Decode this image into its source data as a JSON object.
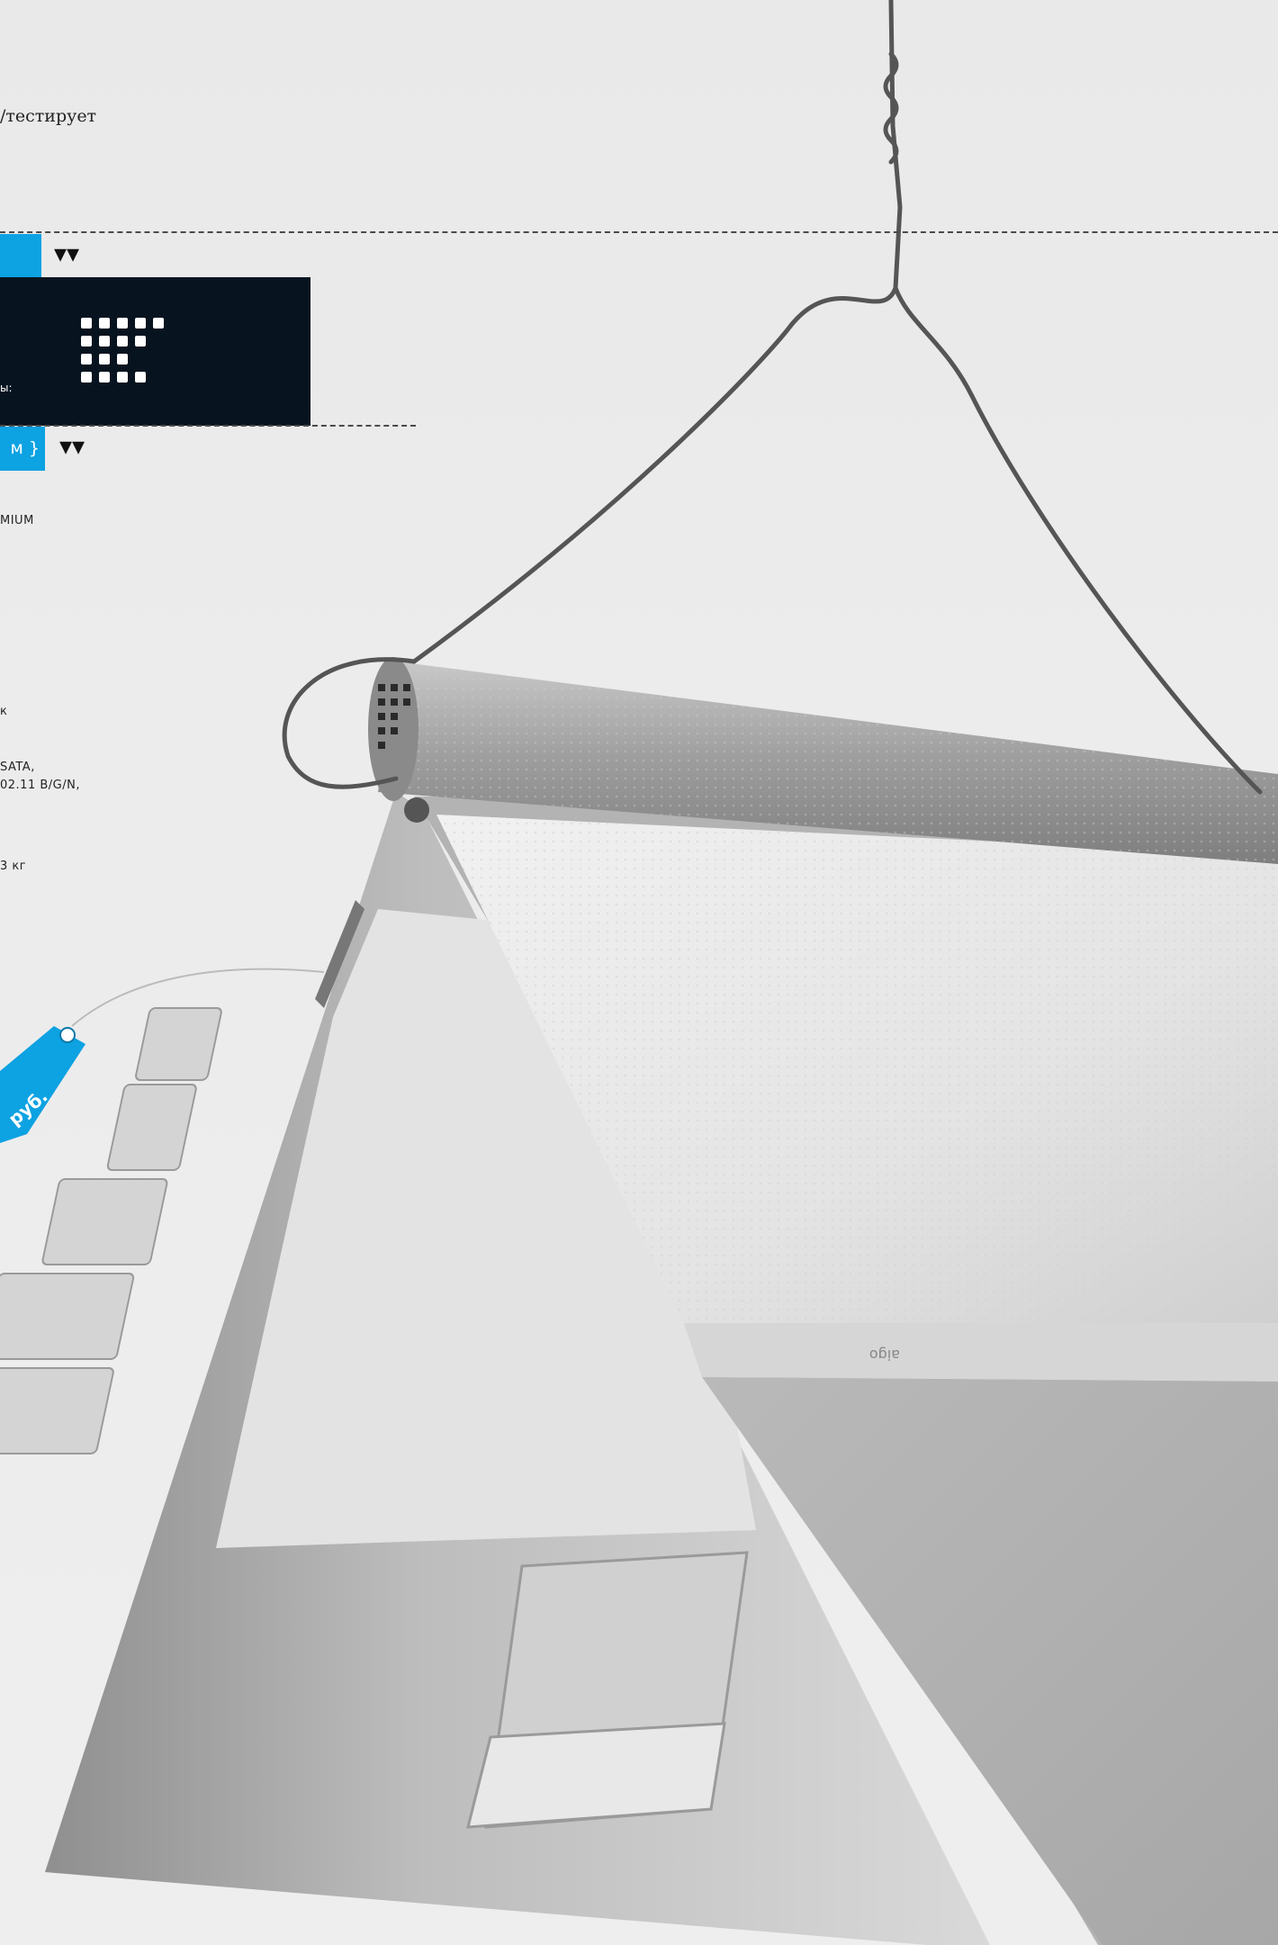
{
  "header": {
    "byline": "/тестирует"
  },
  "specs_panel": {
    "label_specs": "ы:",
    "label_bracket": "м }",
    "lines": [
      "MIUM",
      "к",
      "SATA,",
      "02.11 B/G/N,",
      "3 кг"
    ]
  },
  "price_tag": {
    "text": "руб."
  },
  "laptop": {
    "brand": "aigo"
  },
  "colors": {
    "accent_blue": "#0da2e2",
    "dark_panel": "#07141f",
    "background": "#ebebeb"
  }
}
